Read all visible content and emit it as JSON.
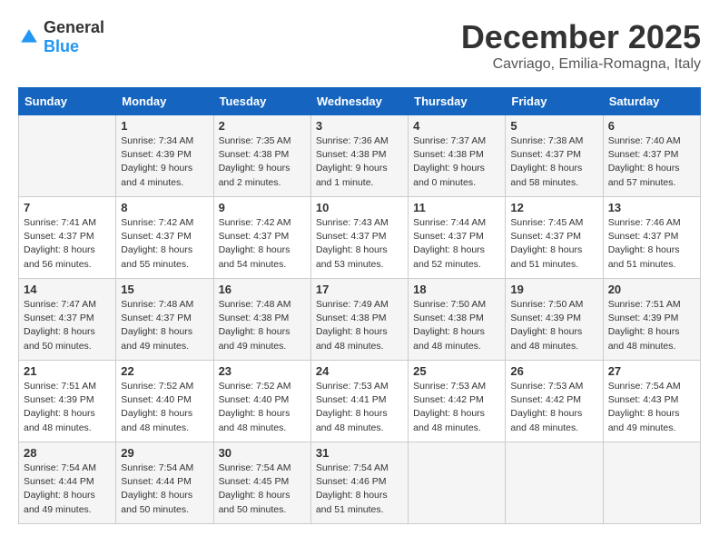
{
  "logo": {
    "general": "General",
    "blue": "Blue"
  },
  "title": "December 2025",
  "location": "Cavriago, Emilia-Romagna, Italy",
  "days_header": [
    "Sunday",
    "Monday",
    "Tuesday",
    "Wednesday",
    "Thursday",
    "Friday",
    "Saturday"
  ],
  "weeks": [
    [
      {
        "day": "",
        "content": ""
      },
      {
        "day": "1",
        "content": "Sunrise: 7:34 AM\nSunset: 4:39 PM\nDaylight: 9 hours\nand 4 minutes."
      },
      {
        "day": "2",
        "content": "Sunrise: 7:35 AM\nSunset: 4:38 PM\nDaylight: 9 hours\nand 2 minutes."
      },
      {
        "day": "3",
        "content": "Sunrise: 7:36 AM\nSunset: 4:38 PM\nDaylight: 9 hours\nand 1 minute."
      },
      {
        "day": "4",
        "content": "Sunrise: 7:37 AM\nSunset: 4:38 PM\nDaylight: 9 hours\nand 0 minutes."
      },
      {
        "day": "5",
        "content": "Sunrise: 7:38 AM\nSunset: 4:37 PM\nDaylight: 8 hours\nand 58 minutes."
      },
      {
        "day": "6",
        "content": "Sunrise: 7:40 AM\nSunset: 4:37 PM\nDaylight: 8 hours\nand 57 minutes."
      }
    ],
    [
      {
        "day": "7",
        "content": "Sunrise: 7:41 AM\nSunset: 4:37 PM\nDaylight: 8 hours\nand 56 minutes."
      },
      {
        "day": "8",
        "content": "Sunrise: 7:42 AM\nSunset: 4:37 PM\nDaylight: 8 hours\nand 55 minutes."
      },
      {
        "day": "9",
        "content": "Sunrise: 7:42 AM\nSunset: 4:37 PM\nDaylight: 8 hours\nand 54 minutes."
      },
      {
        "day": "10",
        "content": "Sunrise: 7:43 AM\nSunset: 4:37 PM\nDaylight: 8 hours\nand 53 minutes."
      },
      {
        "day": "11",
        "content": "Sunrise: 7:44 AM\nSunset: 4:37 PM\nDaylight: 8 hours\nand 52 minutes."
      },
      {
        "day": "12",
        "content": "Sunrise: 7:45 AM\nSunset: 4:37 PM\nDaylight: 8 hours\nand 51 minutes."
      },
      {
        "day": "13",
        "content": "Sunrise: 7:46 AM\nSunset: 4:37 PM\nDaylight: 8 hours\nand 51 minutes."
      }
    ],
    [
      {
        "day": "14",
        "content": "Sunrise: 7:47 AM\nSunset: 4:37 PM\nDaylight: 8 hours\nand 50 minutes."
      },
      {
        "day": "15",
        "content": "Sunrise: 7:48 AM\nSunset: 4:37 PM\nDaylight: 8 hours\nand 49 minutes."
      },
      {
        "day": "16",
        "content": "Sunrise: 7:48 AM\nSunset: 4:38 PM\nDaylight: 8 hours\nand 49 minutes."
      },
      {
        "day": "17",
        "content": "Sunrise: 7:49 AM\nSunset: 4:38 PM\nDaylight: 8 hours\nand 48 minutes."
      },
      {
        "day": "18",
        "content": "Sunrise: 7:50 AM\nSunset: 4:38 PM\nDaylight: 8 hours\nand 48 minutes."
      },
      {
        "day": "19",
        "content": "Sunrise: 7:50 AM\nSunset: 4:39 PM\nDaylight: 8 hours\nand 48 minutes."
      },
      {
        "day": "20",
        "content": "Sunrise: 7:51 AM\nSunset: 4:39 PM\nDaylight: 8 hours\nand 48 minutes."
      }
    ],
    [
      {
        "day": "21",
        "content": "Sunrise: 7:51 AM\nSunset: 4:39 PM\nDaylight: 8 hours\nand 48 minutes."
      },
      {
        "day": "22",
        "content": "Sunrise: 7:52 AM\nSunset: 4:40 PM\nDaylight: 8 hours\nand 48 minutes."
      },
      {
        "day": "23",
        "content": "Sunrise: 7:52 AM\nSunset: 4:40 PM\nDaylight: 8 hours\nand 48 minutes."
      },
      {
        "day": "24",
        "content": "Sunrise: 7:53 AM\nSunset: 4:41 PM\nDaylight: 8 hours\nand 48 minutes."
      },
      {
        "day": "25",
        "content": "Sunrise: 7:53 AM\nSunset: 4:42 PM\nDaylight: 8 hours\nand 48 minutes."
      },
      {
        "day": "26",
        "content": "Sunrise: 7:53 AM\nSunset: 4:42 PM\nDaylight: 8 hours\nand 48 minutes."
      },
      {
        "day": "27",
        "content": "Sunrise: 7:54 AM\nSunset: 4:43 PM\nDaylight: 8 hours\nand 49 minutes."
      }
    ],
    [
      {
        "day": "28",
        "content": "Sunrise: 7:54 AM\nSunset: 4:44 PM\nDaylight: 8 hours\nand 49 minutes."
      },
      {
        "day": "29",
        "content": "Sunrise: 7:54 AM\nSunset: 4:44 PM\nDaylight: 8 hours\nand 50 minutes."
      },
      {
        "day": "30",
        "content": "Sunrise: 7:54 AM\nSunset: 4:45 PM\nDaylight: 8 hours\nand 50 minutes."
      },
      {
        "day": "31",
        "content": "Sunrise: 7:54 AM\nSunset: 4:46 PM\nDaylight: 8 hours\nand 51 minutes."
      },
      {
        "day": "",
        "content": ""
      },
      {
        "day": "",
        "content": ""
      },
      {
        "day": "",
        "content": ""
      }
    ]
  ]
}
